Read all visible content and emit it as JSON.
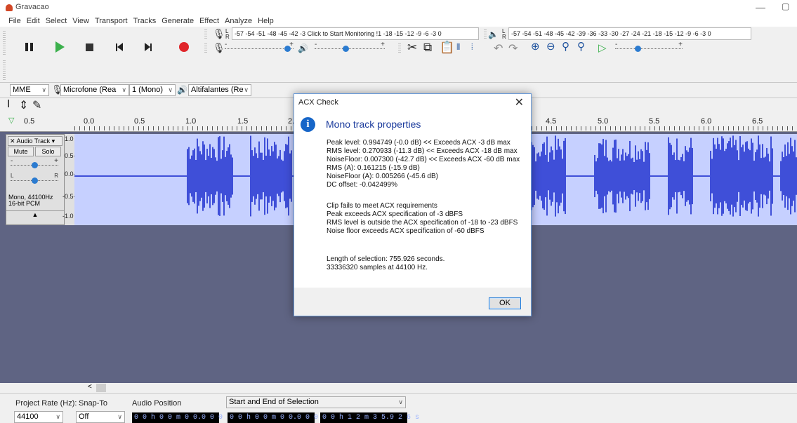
{
  "window": {
    "title": "Gravacao"
  },
  "menu": [
    "File",
    "Edit",
    "Select",
    "View",
    "Transport",
    "Tracks",
    "Generate",
    "Effect",
    "Analyze",
    "Help"
  ],
  "meters": {
    "record_scale": "-57 -54 -51 -48 -45 -42 -3",
    "record_prompt": "Click to Start Monitoring",
    "record_scale_tail": "!1 -18 -15 -12  -9  -6  -3  0",
    "play_scale": "-57 -54 -51 -48 -45 -42 -39 -36 -33 -30 -27 -24 -21 -18 -15 -12  -9  -6  -3  0",
    "left": "L",
    "right": "R"
  },
  "devices": {
    "host": "MME",
    "mic": "Microfone (Rea",
    "channels": "1 (Mono)",
    "speaker": "Altifalantes (Re"
  },
  "ruler": {
    "speed": "0.5",
    "ticks": [
      "0.0",
      "0.5",
      "1.0",
      "1.5",
      "2.0",
      "4.5",
      "5.0",
      "5.5",
      "6.0",
      "6.5"
    ]
  },
  "track": {
    "name": "Audio Track",
    "mute": "Mute",
    "solo": "Solo",
    "gain_minus": "-",
    "gain_plus": "+",
    "pan_left": "L",
    "pan_right": "R",
    "info": "Mono, 44100Hz\n16-bit PCM",
    "scale": [
      "1.0",
      "0.5-",
      "0.0-",
      "-0.5-",
      "-1.0"
    ]
  },
  "selection_bar": {
    "project_rate_label": "Project Rate (Hz):",
    "project_rate": "44100",
    "snap_label": "Snap-To",
    "snap_value": "Off",
    "audio_position_label": "Audio Position",
    "selection_label": "Start and End of Selection",
    "audio_position": "0 0 h 0 0 m 0 0.0 0 0 s",
    "selection_start": "0 0 h 0 0 m 0 0.0 0 0 s",
    "selection_end": "0 0 h 1 2 m 3 5.9 2 6 s"
  },
  "dialog": {
    "title": "ACX Check",
    "heading": "Mono track properties",
    "stats": [
      "Peak level: 0.994749 (-0.0 dB)  << Exceeds ACX -3 dB max",
      "RMS level: 0.270933 (-11.3 dB)  << Exceeds ACX -18 dB max",
      "NoiseFloor: 0.007300 (-42.7 dB)  << Exceeds ACX -60 dB max",
      "RMS (A): 0.161215 (-15.9 dB)",
      "NoiseFloor (A): 0.005266 (-45.6 dB)",
      "DC offset: -0.042499%"
    ],
    "results": [
      "Clip fails to meet ACX requirements",
      "Peak exceeds ACX specification of -3 dBFS",
      "RMS level is outside the ACX specification of -18 to -23 dBFS",
      "Noise floor exceeds ACX specification of -60 dBFS"
    ],
    "length": [
      "Length of selection: 755.926 seconds.",
      "33336320 samples at 44100 Hz."
    ],
    "ok": "OK"
  },
  "colors": {
    "track_background": "#5f6483",
    "waveform": "#3f4fd8",
    "waveform_background": "#c6d0ff",
    "record_button": "#e0262b",
    "play_button": "#3bb04c",
    "dialog_heading": "#1a3a9c"
  }
}
